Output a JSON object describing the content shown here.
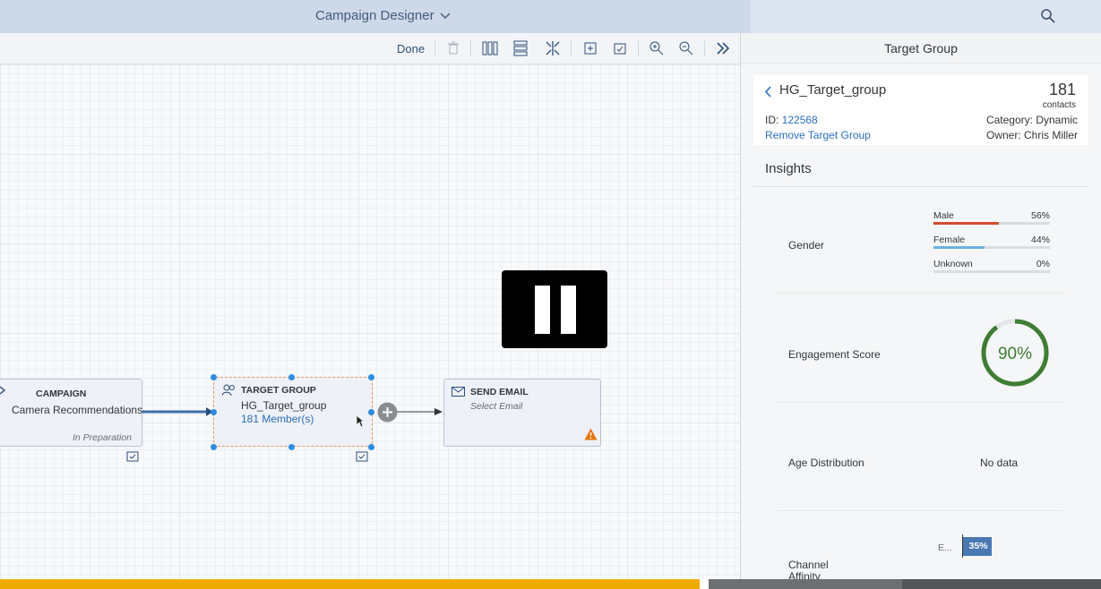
{
  "shell": {
    "app_title": "Campaign Designer",
    "title_icon": "chevron-down-icon",
    "search_icon": "search-icon"
  },
  "toolbar": {
    "done_label": "Done",
    "icons": [
      "delete-icon",
      "horizontal-layout-icon",
      "vertical-layout-icon",
      "collapse-icon",
      "add-before-icon",
      "add-after-icon",
      "zoom-in-icon",
      "zoom-out-icon",
      "expand-panel-icon"
    ]
  },
  "canvas": {
    "campaign_node": {
      "title": "CAMPAIGN",
      "name": "Camera Recommendations",
      "status": "In Preparation"
    },
    "target_group_node": {
      "title": "TARGET GROUP",
      "name": "HG_Target_group",
      "members": "181 Member(s)"
    },
    "send_email_node": {
      "title": "SEND EMAIL",
      "subtitle": "Select Email"
    }
  },
  "panel": {
    "title": "Target Group",
    "group_name": "HG_Target_group",
    "contact_count": "181",
    "contact_unit": "contacts",
    "id_label": "ID:",
    "id_value": "122568",
    "remove_link": "Remove Target Group",
    "category": "Category: Dynamic",
    "owner": "Owner: Chris Miller",
    "insights_heading": "Insights",
    "gender": {
      "label": "Gender",
      "rows": [
        {
          "name": "Male",
          "pct": "56%",
          "fraction": 0.56,
          "color": "#d04a2f"
        },
        {
          "name": "Female",
          "pct": "44%",
          "fraction": 0.44,
          "color": "#6bb2dc"
        },
        {
          "name": "Unknown",
          "pct": "0%",
          "fraction": 0.0,
          "color": "#9aa3ad"
        }
      ]
    },
    "engagement": {
      "label": "Engagement Score",
      "value_text": "90%",
      "fraction": 0.9,
      "color": "#3f7d34"
    },
    "age": {
      "label": "Age Distribution",
      "value_text": "No data"
    },
    "channel": {
      "label_line1": "Channel",
      "label_line2": "Affinity",
      "row_label": "E...",
      "row_value": "35%",
      "fraction": 0.35,
      "color": "#4a78b3"
    }
  },
  "colors": {
    "accent_blue": "#2f8ce0",
    "warning": "#e9730c",
    "bottom_progress": "#f0ab00"
  }
}
